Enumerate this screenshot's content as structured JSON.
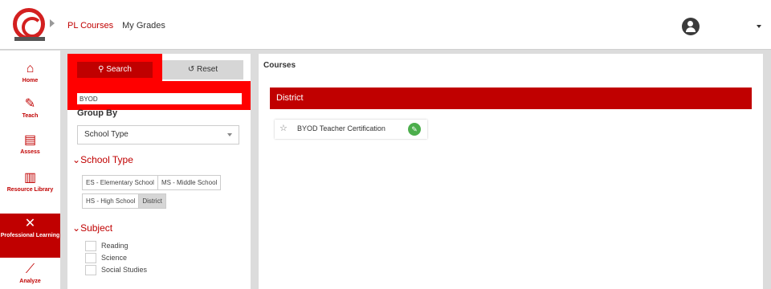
{
  "header": {
    "nav": [
      "PL Courses",
      "My Grades"
    ]
  },
  "sidebar": {
    "items": [
      {
        "label": "Home",
        "icon": "home-icon"
      },
      {
        "label": "Teach",
        "icon": "teach-icon"
      },
      {
        "label": "Assess",
        "icon": "assess-icon"
      },
      {
        "label": "Resource Library",
        "icon": "library-icon"
      },
      {
        "label": "Professional Learning",
        "icon": "tools-icon",
        "active": true
      },
      {
        "label": "Analyze",
        "icon": "chart-icon"
      }
    ]
  },
  "search": {
    "search_label": "Search",
    "reset_label": "Reset",
    "keyword_value": "BYOD",
    "group_by_label": "Group By",
    "group_by_value": "School Type",
    "school_type_heading": "School Type",
    "school_types": [
      "ES - Elementary School",
      "MS - Middle School",
      "HS - High School",
      "District"
    ],
    "selected_school_type": "District",
    "subject_heading": "Subject",
    "subjects": [
      "Reading",
      "Science",
      "Social Studies"
    ]
  },
  "courses": {
    "title": "Courses",
    "group_name": "District",
    "items": [
      {
        "name": "BYOD Teacher Certification"
      }
    ]
  },
  "colors": {
    "brand_red": "#c00000",
    "highlight_red": "#ff0000",
    "edit_green": "#4cae4c"
  }
}
